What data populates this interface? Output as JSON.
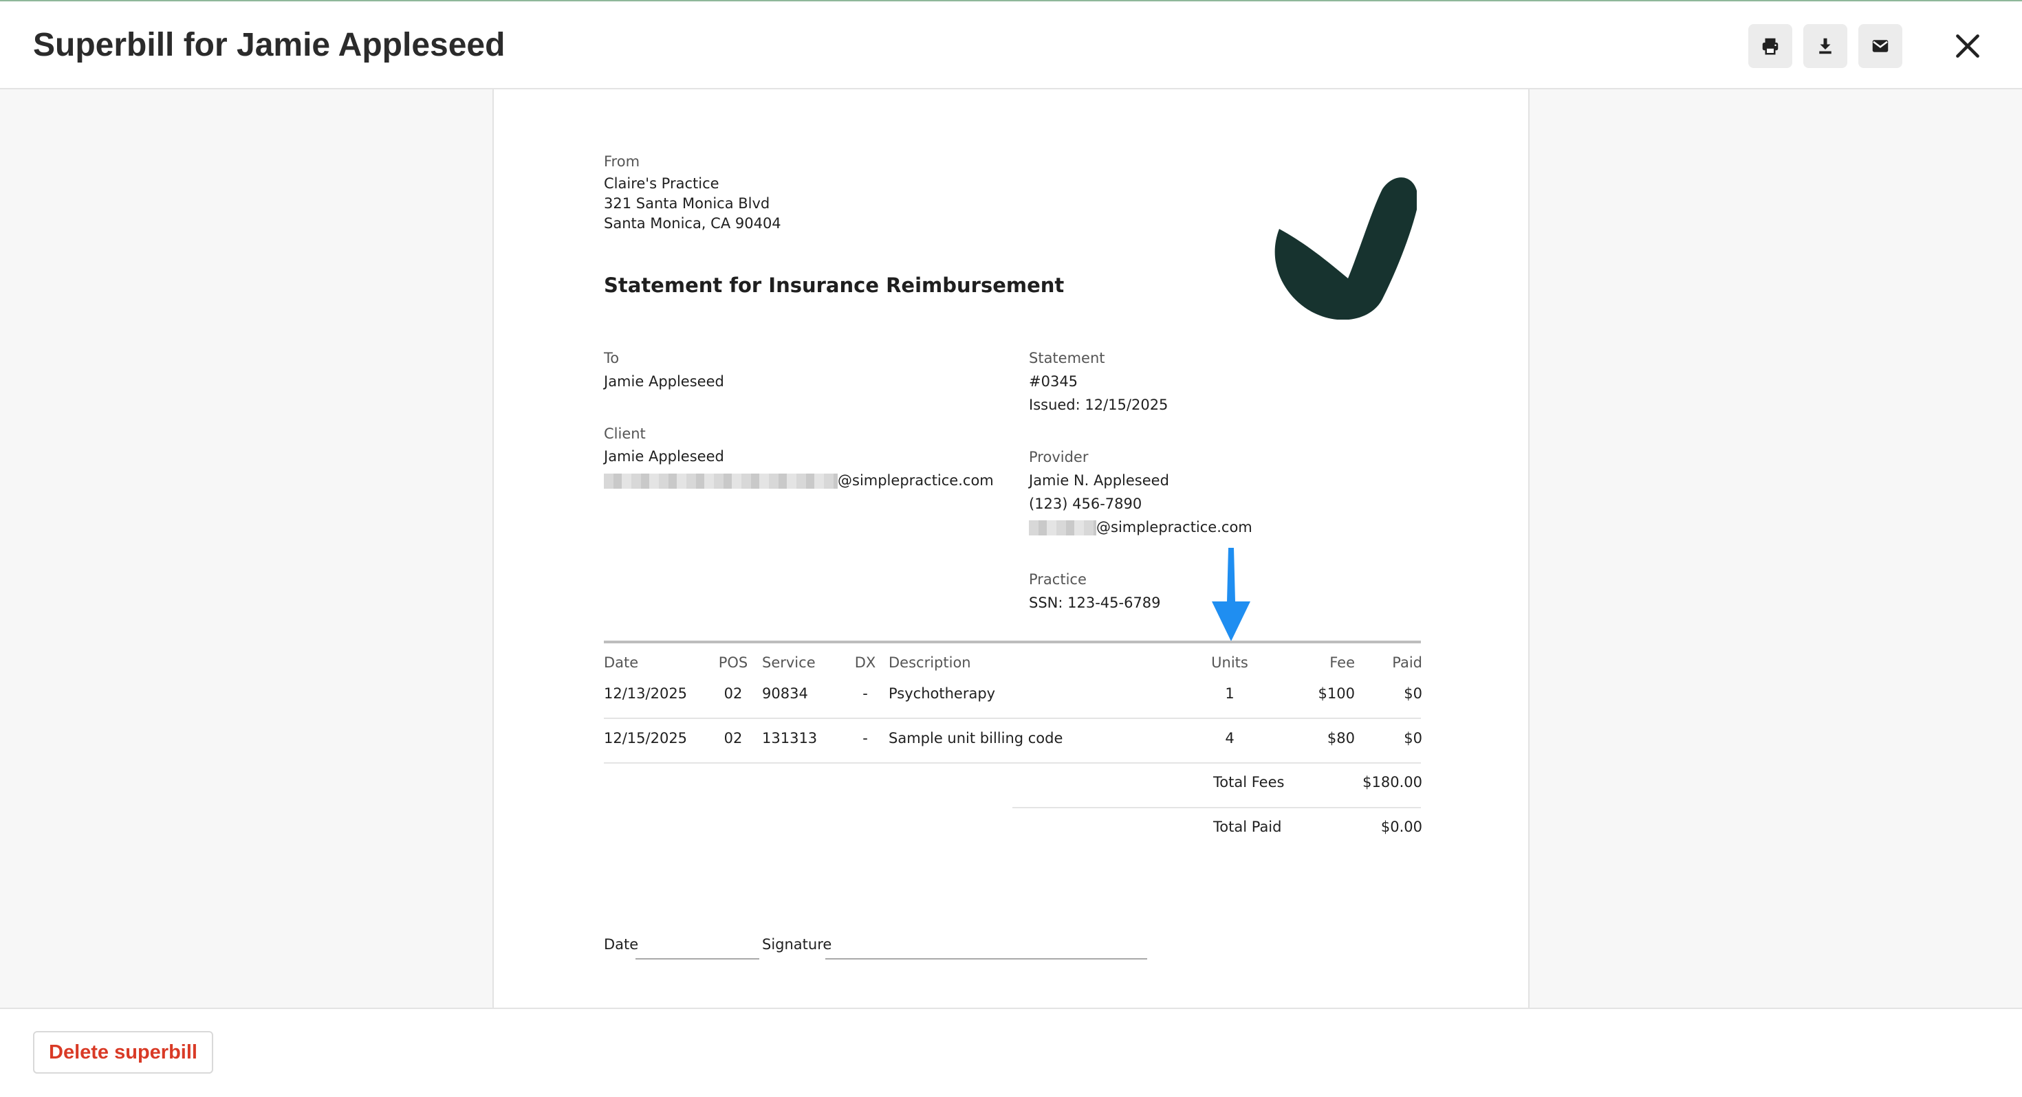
{
  "header": {
    "title": "Superbill for Jamie Appleseed",
    "icons": [
      "printer-icon",
      "download-icon",
      "email-icon",
      "close-icon"
    ]
  },
  "document": {
    "from_label": "From",
    "from_lines": [
      "Claire's Practice",
      "321 Santa Monica Blvd",
      "Santa Monica, CA 90404"
    ],
    "title": "Statement for Insurance Reimbursement",
    "to_label": "To",
    "to_name": "Jamie Appleseed",
    "client_label": "Client",
    "client_name": "Jamie Appleseed",
    "client_email_domain": "@simplepractice.com",
    "statement_label": "Statement",
    "statement_number": "#0345",
    "statement_issued": "Issued: 12/15/2025",
    "provider_label": "Provider",
    "provider_name": "Jamie N. Appleseed",
    "provider_phone": "(123) 456-7890",
    "provider_email_domain": "@simplepractice.com",
    "practice_label": "Practice",
    "practice_ssn": "SSN: 123-45-6789",
    "logo_color": "#17332f",
    "arrow_color": "#1f8ef1"
  },
  "table": {
    "headers": {
      "date": "Date",
      "pos": "POS",
      "service": "Service",
      "dx": "DX",
      "description": "Description",
      "units": "Units",
      "fee": "Fee",
      "paid": "Paid"
    },
    "rows": [
      {
        "date": "12/13/2025",
        "pos": "02",
        "service": "90834",
        "dx": "-",
        "description": "Psychotherapy",
        "units": "1",
        "fee": "$100",
        "paid": "$0"
      },
      {
        "date": "12/15/2025",
        "pos": "02",
        "service": "131313",
        "dx": "-",
        "description": "Sample unit billing code",
        "units": "4",
        "fee": "$80",
        "paid": "$0"
      }
    ],
    "total_fees_label": "Total Fees",
    "total_fees_value": "$180.00",
    "total_paid_label": "Total Paid",
    "total_paid_value": "$0.00"
  },
  "signature": {
    "date_label": "Date",
    "signature_label": "Signature"
  },
  "footer": {
    "delete_label": "Delete superbill",
    "delete_color": "#d93a26"
  }
}
